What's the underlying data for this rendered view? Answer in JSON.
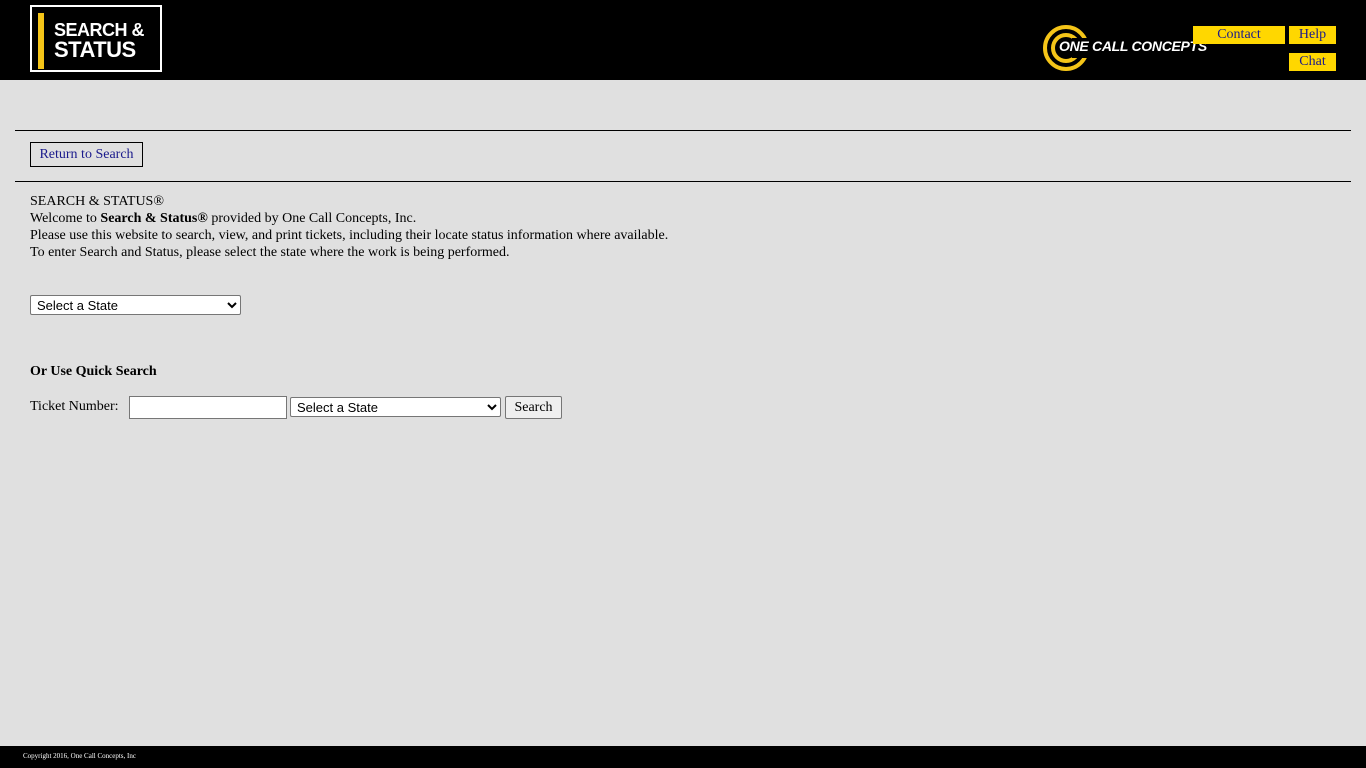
{
  "header": {
    "logo": {
      "line1": "SEARCH &",
      "line2": "STATUS"
    },
    "company_logo_text": "ONE CALL CONCEPTS",
    "buttons": {
      "contact": "Contact",
      "help": "Help",
      "chat": "Chat"
    },
    "colors": {
      "background": "#000000",
      "accent": "#ffd700"
    }
  },
  "nav": {
    "return_label": "Return to Search"
  },
  "intro": {
    "title": "SEARCH & STATUS®",
    "welcome_prefix": "Welcome to ",
    "welcome_bold": "Search & Status®",
    "welcome_suffix": " provided by One Call Concepts, Inc.",
    "line3": "Please use this website to search, view, and print tickets, including their locate status information where available.",
    "line4": "To enter Search and Status, please select the state where the work is being performed."
  },
  "state_select": {
    "selected": "Select a State"
  },
  "quick_search": {
    "heading": "Or Use Quick Search",
    "ticket_label": "Ticket Number:",
    "ticket_value": "",
    "state_selected": "Select a State",
    "search_label": "Search"
  },
  "footer": {
    "copyright": "Copyright 2016, One Call Concepts, Inc"
  }
}
